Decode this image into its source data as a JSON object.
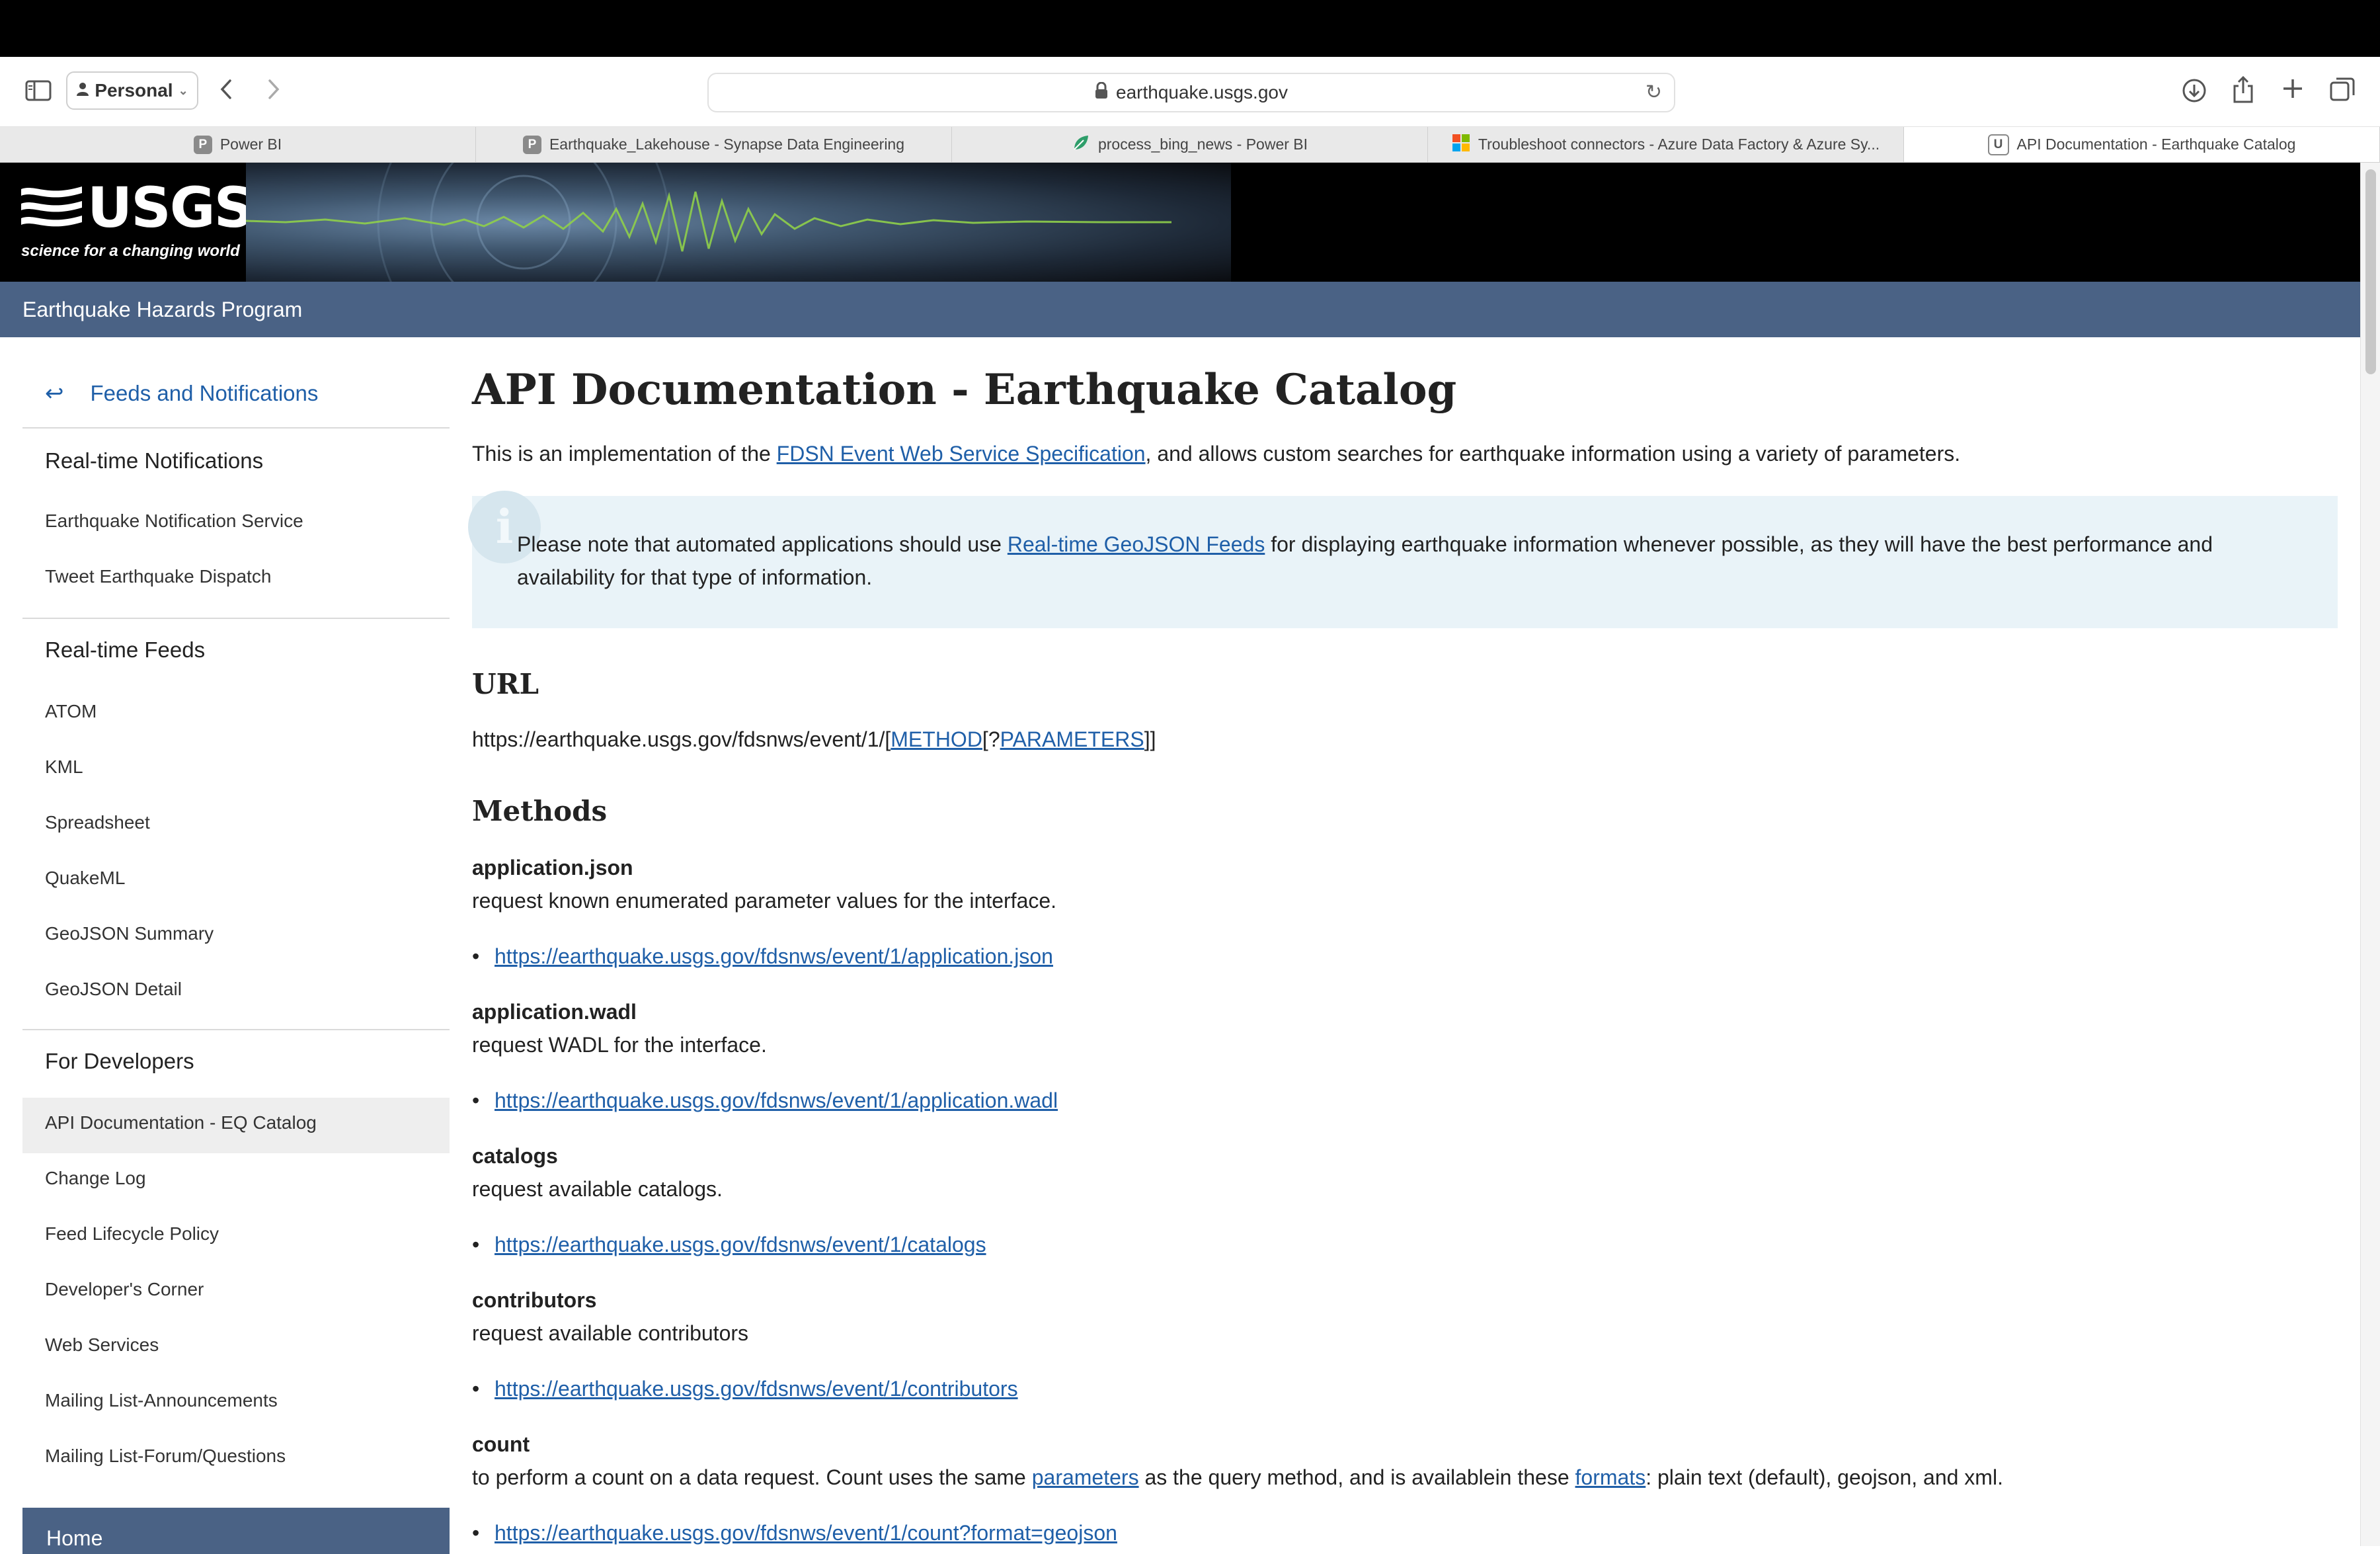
{
  "browser": {
    "profile_label": "Personal",
    "address": "earthquake.usgs.gov",
    "tabs": [
      {
        "title": "Power BI",
        "favicon": "P"
      },
      {
        "title": "Earthquake_Lakehouse - Synapse Data Engineering",
        "favicon": "P"
      },
      {
        "title": "process_bing_news - Power BI",
        "favicon": "leaf"
      },
      {
        "title": "Troubleshoot connectors - Azure Data Factory & Azure Sy...",
        "favicon": "ms"
      },
      {
        "title": "API Documentation - Earthquake Catalog",
        "favicon": "U"
      }
    ]
  },
  "header": {
    "logo_text": "USGS",
    "logo_tagline": "science for a changing world",
    "program": "Earthquake Hazards Program"
  },
  "sidebar": {
    "back_label": "Feeds and Notifications",
    "sections": [
      {
        "title": "Real-time Notifications",
        "items": [
          "Earthquake Notification Service",
          "Tweet Earthquake Dispatch"
        ]
      },
      {
        "title": "Real-time Feeds",
        "items": [
          "ATOM",
          "KML",
          "Spreadsheet",
          "QuakeML",
          "GeoJSON Summary",
          "GeoJSON Detail"
        ]
      },
      {
        "title": "For Developers",
        "items": [
          "API Documentation - EQ Catalog",
          "Change Log",
          "Feed Lifecycle Policy",
          "Developer's Corner",
          "Web Services",
          "Mailing List-Announcements",
          "Mailing List-Forum/Questions"
        ]
      }
    ],
    "home_label": "Home"
  },
  "main": {
    "title": "API Documentation - Earthquake Catalog",
    "intro": {
      "before": "This is an implementation of the ",
      "link": "FDSN Event Web Service Specification",
      "after": ", and allows custom searches for earthquake information using a variety of parameters."
    },
    "note": {
      "icon": "i",
      "before": "Please note that automated applications should use ",
      "link": "Real-time GeoJSON Feeds",
      "after": " for displaying earthquake information whenever possible, as they will have the best performance and availability for that type of information."
    },
    "url_heading": "URL",
    "url": {
      "prefix": "https://earthquake.usgs.gov/fdsnws/event/1/[",
      "method": "METHOD",
      "middle": "[?",
      "params": "PARAMETERS",
      "suffix": "]]"
    },
    "methods_heading": "Methods",
    "methods": [
      {
        "name": "application.json",
        "desc": "request known enumerated parameter values for the interface.",
        "link": "https://earthquake.usgs.gov/fdsnws/event/1/application.json"
      },
      {
        "name": "application.wadl",
        "desc": "request WADL for the interface.",
        "link": "https://earthquake.usgs.gov/fdsnws/event/1/application.wadl"
      },
      {
        "name": "catalogs",
        "desc": "request available catalogs.",
        "link": "https://earthquake.usgs.gov/fdsnws/event/1/catalogs"
      },
      {
        "name": "contributors",
        "desc": "request available contributors",
        "link": "https://earthquake.usgs.gov/fdsnws/event/1/contributors"
      }
    ],
    "count": {
      "name": "count",
      "desc_1": "to perform a count on a data request. Count uses the same ",
      "link_1": "parameters",
      "desc_2": " as the query method, and is availablein these ",
      "link_2": "formats",
      "desc_3": ": plain text (default), geojson, and xml.",
      "link": "https://earthquake.usgs.gov/fdsnws/event/1/count?format=geojson"
    }
  }
}
